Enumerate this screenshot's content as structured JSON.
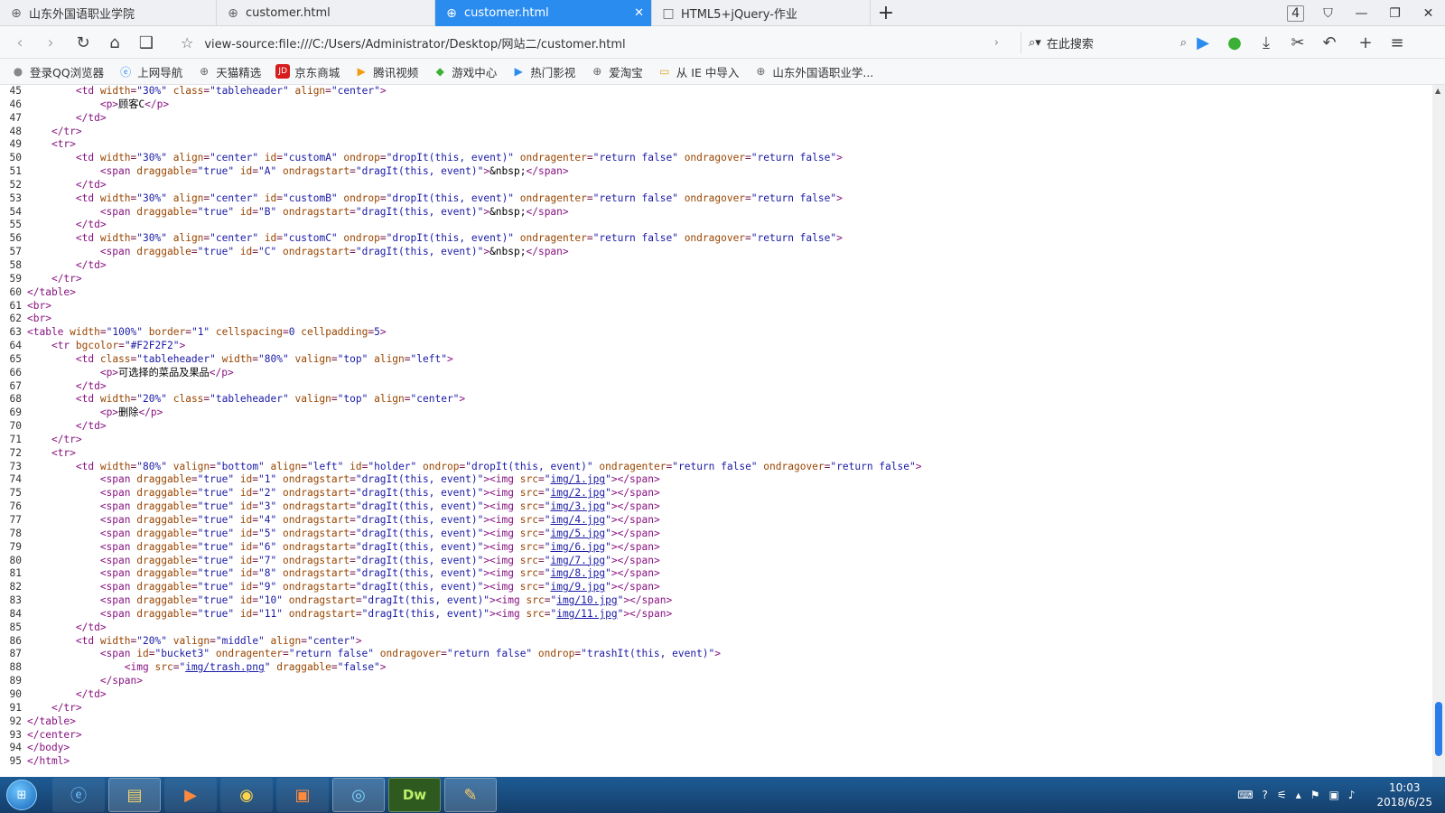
{
  "tabs": [
    {
      "label": "山东外国语职业学院",
      "active": false
    },
    {
      "label": "customer.html",
      "active": false
    },
    {
      "label": "customer.html",
      "active": true
    },
    {
      "label": "HTML5+jQuery-作业",
      "active": false
    }
  ],
  "tab_count": "4",
  "address": "view-source:file:///C:/Users/Administrator/Desktop/网站二/customer.html",
  "search_placeholder": "在此搜索",
  "bookmarks": [
    "登录QQ浏览器",
    "上网导航",
    "天猫精选",
    "京东商城",
    "腾讯视频",
    "游戏中心",
    "热门影视",
    "爱淘宝",
    "从 IE 中导入",
    "山东外国语职业学..."
  ],
  "clock": {
    "time": "10:03",
    "date": "2018/6/25"
  },
  "accent_color": "#2b8cf0"
}
